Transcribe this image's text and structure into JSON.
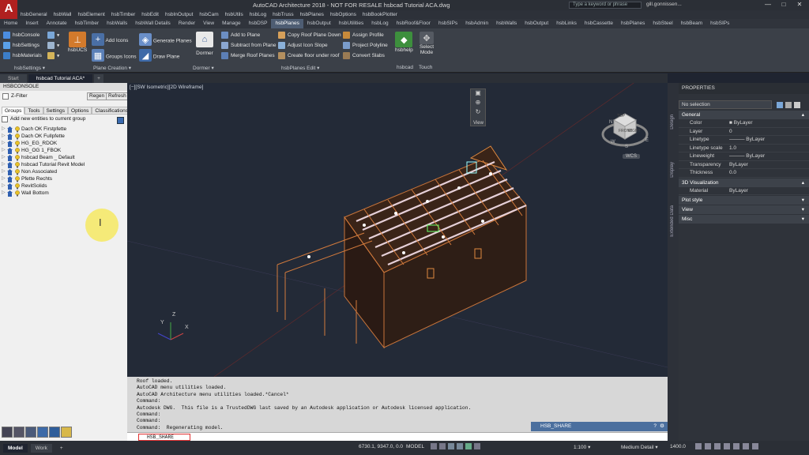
{
  "app": {
    "logo": "A",
    "title": "AutoCAD Architecture 2018 - NOT FOR RESALE   hsbcad Tutorial ACA.dwg",
    "search_placeholder": "Type a keyword or phrase",
    "user": "gill.gonnissen...",
    "win_min": "—",
    "win_max": "□",
    "win_close": "✕"
  },
  "menu": [
    "hsbGeneral",
    "hsbWall",
    "hsbElement",
    "hsbTimber",
    "hsbEdit",
    "hsbInOutput",
    "hsbCam",
    "hsbUtils",
    "hsbLog",
    "hsbTruss",
    "hsbPlanes",
    "hsbOptions",
    "hsbBookPlotter"
  ],
  "tabs": [
    "Home",
    "Insert",
    "Annotate",
    "hsbTimber",
    "hsbWalls",
    "hsbWall Details",
    "Render",
    "View",
    "Manage",
    "hsbDSP",
    "hsbPlanes",
    "hsbOutput",
    "hsbUtilities",
    "hsbLog",
    "hsbRoof&Floor",
    "hsbSIPs",
    "hsbAdmin",
    "hsbWalls",
    "hsbOutput",
    "hsbLinks",
    "hsbCassette",
    "hsbPlanes",
    "hsbSteel",
    "hsbBeam",
    "hsbSIPs"
  ],
  "active_tab_index": 10,
  "ribbon": {
    "settings": {
      "items": [
        "hsbConsole",
        "hsbSettings",
        "hsbMaterials"
      ],
      "label": "hsbSettings ▾"
    },
    "plane_creation": {
      "hsbucs": "hsbUCS",
      "add_icons": "Add Icons",
      "groups_icons": "Groups Icons",
      "generate_planes": "Generate Planes",
      "draw_plane": "Draw Plane",
      "label": "Plane Creation ▾"
    },
    "dormer": {
      "button": "Dormer",
      "label": "Dormer ▾"
    },
    "planes_edit": {
      "items_col1": [
        "Add to Plane",
        "Subtract from Plane",
        "Merge Roof Planes"
      ],
      "items_col2": [
        "Copy Roof Plane Down",
        "Adjust Icon Slope",
        "Create floor under roof"
      ],
      "items_col3": [
        "Assign Profile",
        "Project Polyline",
        "Convert Slabs"
      ],
      "label": "hsbPlanes Edit ▾"
    },
    "hsbcad": {
      "button": "hsbhelp",
      "label": "hsbcad"
    },
    "touch": {
      "button_line1": "Select",
      "button_line2": "Mode",
      "label": "Touch"
    }
  },
  "doc_tabs": [
    "Start",
    "hsbcad Tutorial ACA*"
  ],
  "doc_tab_add": "+",
  "console": {
    "header": "HSBCONSOLE",
    "zfilter": "Z-Filter",
    "regen": "Regen",
    "refresh": "Refresh",
    "tabs": [
      "Groups",
      "Tools",
      "Settings",
      "Options",
      "Classifications"
    ],
    "add_new": "Add new entities to current group",
    "tree": [
      "Dach OK Firstpfette",
      "Dach OK Fullpfette",
      "HG_EG_RDOK",
      "HG_OG 1_FBOK",
      "hsbcad Beam _ Default",
      "hsbcad Tutorial Revit Model",
      "Non Associated",
      "Pfette Rechts",
      "RevitSolids",
      "Wall Bottom"
    ]
  },
  "viewport": {
    "label": "[−][SW Isometric][2D Wireframe]",
    "view_label": "View",
    "wcs": "WCS",
    "cube_faces": [
      "TOP",
      "FRONT",
      "RIGHT"
    ],
    "compass": [
      "N",
      "W",
      "S",
      "E"
    ],
    "axes": [
      "Y",
      "X",
      "Z"
    ],
    "cursor_glyph": "I"
  },
  "command": {
    "history": [
      "Roof loaded.",
      "AutoCAD menu utilities loaded.",
      "AutoCAD Architecture menu utilities loaded.*Cancel*",
      "Command:",
      "Autodesk DWG.  This file is a TrustedDWG last saved by an Autodesk application or Autodesk licensed application.",
      "Command:",
      "Command:",
      "Command:  Regenerating model."
    ],
    "input": "HSB_SHARE",
    "popup": "HSB_SHARE"
  },
  "properties": {
    "header": "PROPERTIES",
    "selection": "No selection",
    "general_title": "General",
    "general": [
      [
        "Color",
        "■ ByLayer"
      ],
      [
        "Layer",
        "0"
      ],
      [
        "Linetype",
        "——— ByLayer"
      ],
      [
        "Linetype scale",
        "1.0"
      ],
      [
        "Lineweight",
        "——— ByLayer"
      ],
      [
        "Transparency",
        "ByLayer"
      ],
      [
        "Thickness",
        "0.0"
      ]
    ],
    "viz_title": "3D Visualization",
    "viz": [
      [
        "Material",
        "ByLayer"
      ]
    ],
    "collapsed": [
      "Plot style",
      "View",
      "Misc"
    ],
    "side_tabs": [
      "Design",
      "Display",
      "Extended Data"
    ]
  },
  "status": {
    "model": "Model",
    "work": "Work",
    "add": "+",
    "coords": "6730.1, 9347.0, 0.0",
    "model_space": "MODEL",
    "scale": "1:100 ▾",
    "detail": "Medium Detail ▾",
    "value": "1400.0"
  }
}
